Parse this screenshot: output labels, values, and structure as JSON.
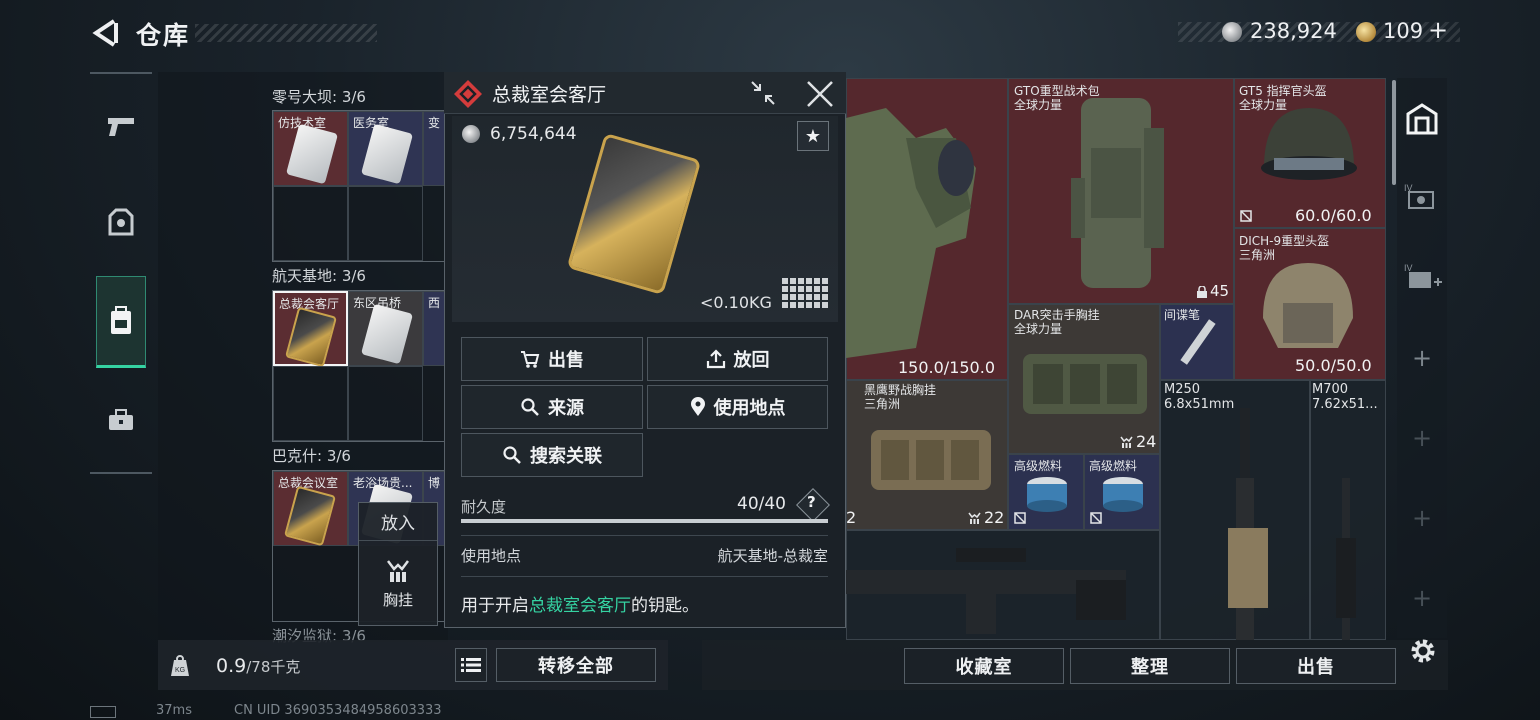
{
  "header": {
    "title": "仓库",
    "silver_amount": "238,924",
    "gold_amount": "109",
    "gold_add": "+"
  },
  "nav": {
    "items": [
      "weapon",
      "armor",
      "backpack",
      "toolbox"
    ]
  },
  "containers": {
    "sections": [
      {
        "label": "零号大坝: 3/6",
        "slots": [
          "仿技术室",
          "医务室",
          "变"
        ]
      },
      {
        "label": "航天基地: 3/6",
        "slots": [
          "总裁会客厅",
          "东区吊桥",
          "西"
        ]
      },
      {
        "label": "巴克什: 3/6",
        "slots": [
          "总裁会议室",
          "老浴场贵...",
          "博"
        ]
      },
      {
        "label": "潮汐监狱: 3/6"
      }
    ],
    "put_in_tooltip": {
      "header": "放入",
      "category": "胸挂"
    }
  },
  "bottom_left": {
    "weight_value": "0.9",
    "weight_max": "/78千克",
    "transfer_all": "转移全部"
  },
  "popup": {
    "title": "总裁室会客厅",
    "price": "6,754,644",
    "weight": "<0.10KG",
    "buttons": {
      "sell": "出售",
      "return": "放回",
      "source": "来源",
      "use_location": "使用地点",
      "search_related": "搜索关联"
    },
    "durability_label": "耐久度",
    "durability_value": "40/40",
    "durability_fraction": 1.0,
    "help": "?",
    "location_label": "使用地点",
    "location_value": "航天基地-总裁室",
    "desc_before": "用于开启",
    "desc_highlight": "总裁室会客厅",
    "desc_after": "的钥匙。",
    "highlight_color": "#35d3a2"
  },
  "inventory": {
    "items": [
      {
        "name": "",
        "sub": "",
        "value": "150.0/150.0"
      },
      {
        "name": "GTO重型战术包",
        "sub": "全球力量",
        "value": "45"
      },
      {
        "name": "GT5 指挥官头盔",
        "sub": "全球力量",
        "value": "60.0/60.0"
      },
      {
        "name": "DICH-9重型头盔",
        "sub": "三角洲",
        "value": "50.0/50.0"
      },
      {
        "name": "DAR突击手胸挂",
        "sub": "全球力量",
        "value": "24"
      },
      {
        "name": "间谍笔",
        "sub": "",
        "value": ""
      },
      {
        "name": "黑鹰野战胸挂",
        "sub": "三角洲",
        "value": "22"
      },
      {
        "name": "高级燃料",
        "sub": "",
        "value": ""
      },
      {
        "name": "高级燃料",
        "sub": "",
        "value": ""
      },
      {
        "name": "M250",
        "sub": "6.8x51mm",
        "value": ""
      },
      {
        "name": "M700",
        "sub": "7.62x51...",
        "value": ""
      },
      {
        "name": "",
        "sub": "",
        "value": "2"
      }
    ]
  },
  "bottom_right": {
    "collection": "收藏室",
    "organize": "整理",
    "sell": "出售"
  },
  "status": {
    "ping": "37ms",
    "uid": "CN UID 3690353484958603333"
  }
}
